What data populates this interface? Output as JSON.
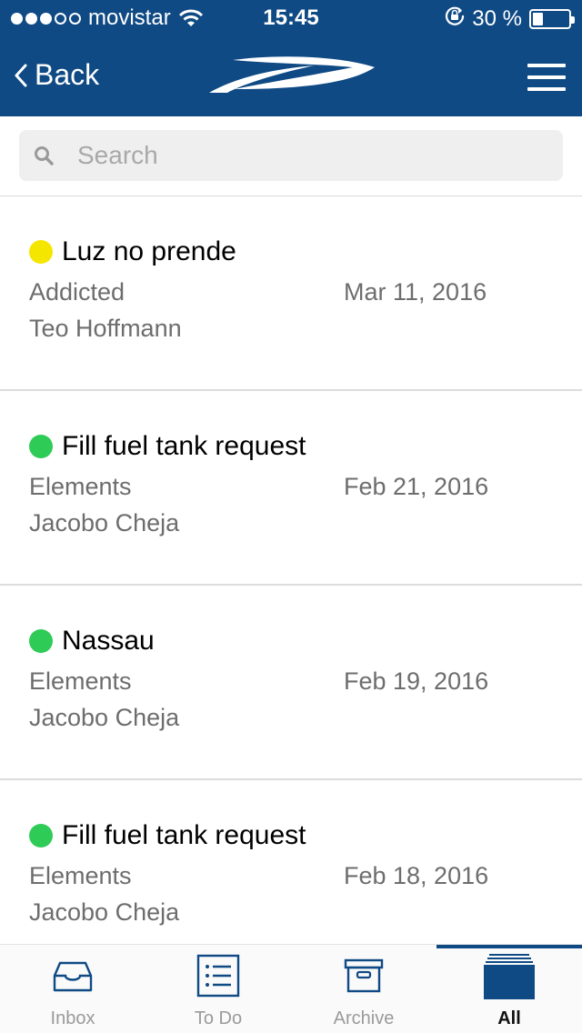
{
  "status_bar": {
    "carrier": "movistar",
    "time": "15:45",
    "battery": "30 %",
    "battery_level": 0.3
  },
  "nav": {
    "back_label": "Back",
    "logo_icon": "boat-logo-icon",
    "menu_icon": "hamburger-menu-icon"
  },
  "search": {
    "placeholder": "Search",
    "value": ""
  },
  "colors": {
    "brand": "#0f4a84",
    "status_yellow": "#f5e600",
    "status_green": "#2ecc57"
  },
  "items": [
    {
      "title": "Luz no prende",
      "company": "Addicted",
      "date": "Mar 11, 2016",
      "person": "Teo Hoffmann",
      "status_color": "#f5e600"
    },
    {
      "title": "Fill fuel tank request",
      "company": "Elements",
      "date": "Feb 21, 2016",
      "person": "Jacobo Cheja",
      "status_color": "#2ecc57"
    },
    {
      "title": "Nassau",
      "company": "Elements",
      "date": "Feb 19, 2016",
      "person": "Jacobo Cheja",
      "status_color": "#2ecc57"
    },
    {
      "title": "Fill fuel tank request",
      "company": "Elements",
      "date": "Feb 18, 2016",
      "person": "Jacobo Cheja",
      "status_color": "#2ecc57"
    }
  ],
  "tabs": [
    {
      "label": "Inbox",
      "icon": "inbox-tray-icon",
      "active": false
    },
    {
      "label": "To Do",
      "icon": "checklist-icon",
      "active": false
    },
    {
      "label": "Archive",
      "icon": "archive-box-icon",
      "active": false
    },
    {
      "label": "All",
      "icon": "stacked-box-icon",
      "active": true
    }
  ]
}
